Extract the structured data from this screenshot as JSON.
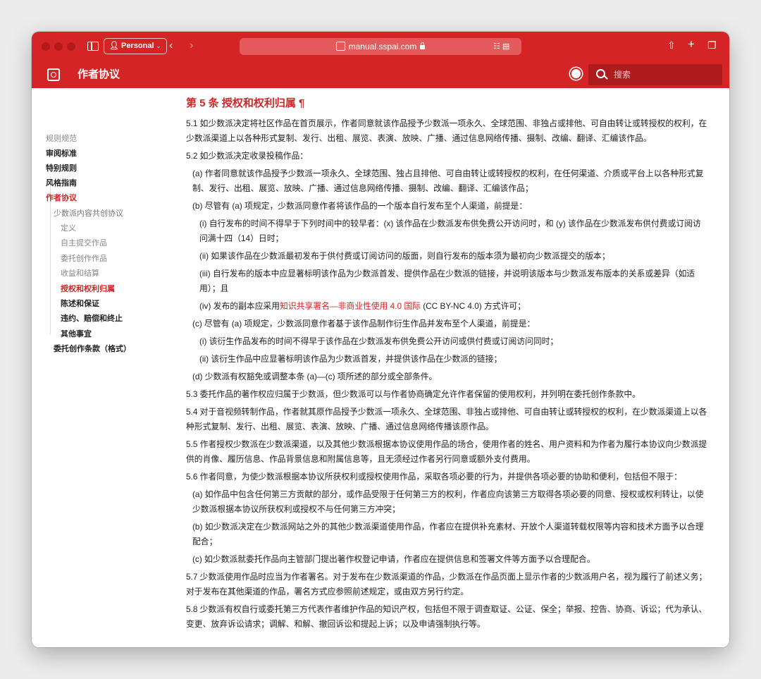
{
  "browser": {
    "profile": "Personal",
    "url": "manual.sspai.com"
  },
  "site": {
    "title": "作者协议",
    "search_placeholder": "搜索"
  },
  "nav": {
    "category": "规则规范",
    "items": [
      "审阅标准",
      "特别规则",
      "风格指南"
    ],
    "active": "作者协议",
    "sub_title": "少数派内容共创协议",
    "leaves": [
      "定义",
      "自主提交作品",
      "委托创作作品",
      "收益和结算",
      "授权和权利归属",
      "陈述和保证",
      "违约、赔偿和终止",
      "其他事宜"
    ],
    "last": "委托创作条款（格式）"
  },
  "article": {
    "heading": "第 5 条 授权和权利归属 ¶",
    "p5_1": "5.1 如少数派决定将社区作品在首页展示，作者同意就该作品授予少数派一项永久、全球范围、非独占或排他、可自由转让或转授权的权利，在少数派渠道上以各种形式复制、发行、出租、展览、表演、放映、广播、通过信息网络传播、摄制、改编、翻译、汇编该作品。",
    "p5_2": "5.2 如少数派决定收录投稿作品：",
    "p5_2a": "(a) 作者同意就该作品授予少数派一项永久、全球范围、独占且排他、可自由转让或转授权的权利，在任何渠道、介质或平台上以各种形式复制、发行、出租、展览、放映、广播、通过信息网络传播、摄制、改编、翻译、汇编该作品；",
    "p5_2b": "(b) 尽管有 (a) 项规定，少数派同意作者将该作品的一个版本自行发布至个人渠道，前提是：",
    "p5_2b_i": "(i) 自行发布的时间不得早于下列时间中的较早者：(x) 该作品在少数派发布供免费公开访问时，和 (y) 该作品在少数派发布供付费或订阅访问满十四（14）日时；",
    "p5_2b_ii": "(ii) 如果该作品在少数派最初发布于供付费或订阅访问的版面，则自行发布的版本须为最初向少数派提交的版本；",
    "p5_2b_iii": "(iii) 自行发布的版本中应显著标明该作品为少数派首发、提供作品在少数派的链接，并说明该版本与少数派发布版本的关系或差异（如适用）；且",
    "p5_2b_iv_pre": "(iv) 发布的副本应采用",
    "p5_2b_iv_link": "知识共享署名—非商业性使用 4.0 国际",
    "p5_2b_iv_post": " (CC BY-NC 4.0) 方式许可；",
    "p5_2c": "(c) 尽管有 (a) 项规定，少数派同意作者基于该作品制作衍生作品并发布至个人渠道，前提是：",
    "p5_2c_i": "(i) 该衍生作品发布的时间不得早于该作品在少数派发布供免费公开访问或供付费或订阅访问同时；",
    "p5_2c_ii": "(ii) 该衍生作品中应显著标明该作品为少数派首发，并提供该作品在少数派的链接；",
    "p5_2d": "(d) 少数派有权豁免或调整本条 (a)—(c) 项所述的部分或全部条件。",
    "p5_3": "5.3 委托作品的著作权应归属于少数派，但少数派可以与作者协商确定允许作者保留的使用权利，并列明在委托创作条款中。",
    "p5_4": "5.4 对于音视频转制作品，作者就其原作品授予少数派一项永久、全球范围、非独占或排他、可自由转让或转授权的权利，在少数派渠道上以各种形式复制、发行、出租、展览、表演、放映、广播、通过信息网络传播该原作品。",
    "p5_5": "5.5 作者授权少数派在少数派渠道，以及其他少数派根据本协议使用作品的场合，使用作者的姓名、用户资料和为作者为履行本协议向少数派提供的肖像、履历信息、作品背景信息和附属信息等，且无须经过作者另行同意或额外支付费用。",
    "p5_6": "5.6 作者同意，为使少数派根据本协议所获权利或授权使用作品，采取各项必要的行为，并提供各项必要的协助和便利，包括但不限于：",
    "p5_6a": "(a) 如作品中包含任何第三方贡献的部分，或作品受限于任何第三方的权利，作者应向该第三方取得各项必要的同意、授权或权利转让，以使少数派根据本协议所获权利或授权不与任何第三方冲突；",
    "p5_6b": "(b) 如少数派决定在少数派网站之外的其他少数派渠道使用作品，作者应在提供补充素材、开放个人渠道转载权限等内容和技术方面予以合理配合；",
    "p5_6c": "(c) 如少数派就委托作品向主管部门提出著作权登记申请，作者应在提供信息和签署文件等方面予以合理配合。",
    "p5_7": "5.7 少数派使用作品时应当为作者署名。对于发布在少数派渠道的作品，少数派在作品页面上显示作者的少数派用户名，视为履行了前述义务；对于发布在其他渠道的作品，署名方式应参照前述规定，或由双方另行约定。",
    "p5_8": "5.8 少数派有权自行或委托第三方代表作者维护作品的知识产权，包括但不限于调查取证、公证、保全；举报、控告、协商、诉讼；代为承认、变更、放弃诉讼请求；调解、和解、撤回诉讼和提起上诉；以及申请强制执行等。"
  }
}
